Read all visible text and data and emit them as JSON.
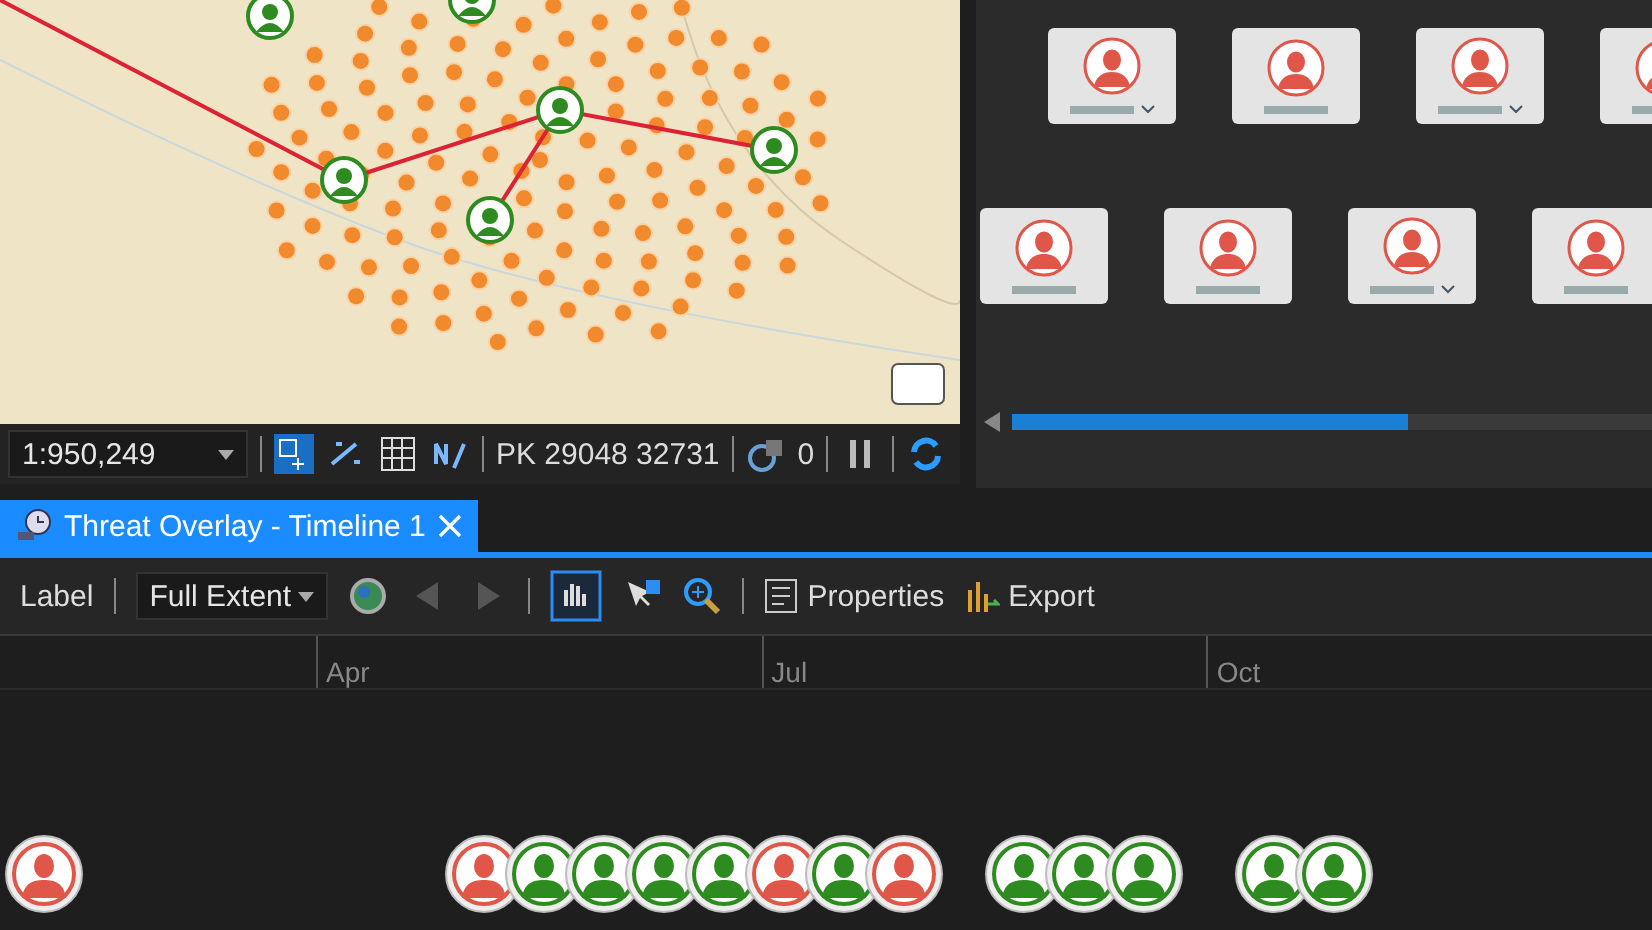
{
  "map": {
    "scale": "1:950,249",
    "coordinates": "PK 29048 32731",
    "selection_count": "0"
  },
  "org_chart": {
    "rows": [
      [
        {
          "expandable": true
        },
        {
          "expandable": false
        },
        {
          "expandable": true
        },
        {
          "expandable": false
        }
      ],
      [
        {
          "expandable": false
        },
        {
          "expandable": false
        },
        {
          "expandable": true
        },
        {
          "expandable": false
        }
      ]
    ],
    "scroll": {
      "level": 0.62
    }
  },
  "tab": {
    "title": "Threat Overlay - Timeline 1",
    "selected": true
  },
  "toolbar": {
    "label_button": "Label",
    "extent": "Full Extent",
    "properties": "Properties",
    "export": "Export"
  },
  "axis": {
    "labels": [
      "Apr",
      "Jul",
      "Oct"
    ]
  },
  "markers": [
    [
      {
        "color": "#e0574a"
      }
    ],
    [
      {
        "color": "#e0574a"
      },
      {
        "color": "#2e8b1f"
      },
      {
        "color": "#2e8b1f"
      },
      {
        "color": "#2e8b1f"
      },
      {
        "color": "#2e8b1f"
      },
      {
        "color": "#e0574a"
      },
      {
        "color": "#2e8b1f"
      },
      {
        "color": "#e0574a"
      }
    ],
    [
      {
        "color": "#2e8b1f"
      },
      {
        "color": "#2e8b1f"
      },
      {
        "color": "#2e8b1f"
      }
    ],
    [
      {
        "color": "#2e8b1f"
      },
      {
        "color": "#2e8b1f"
      }
    ]
  ]
}
